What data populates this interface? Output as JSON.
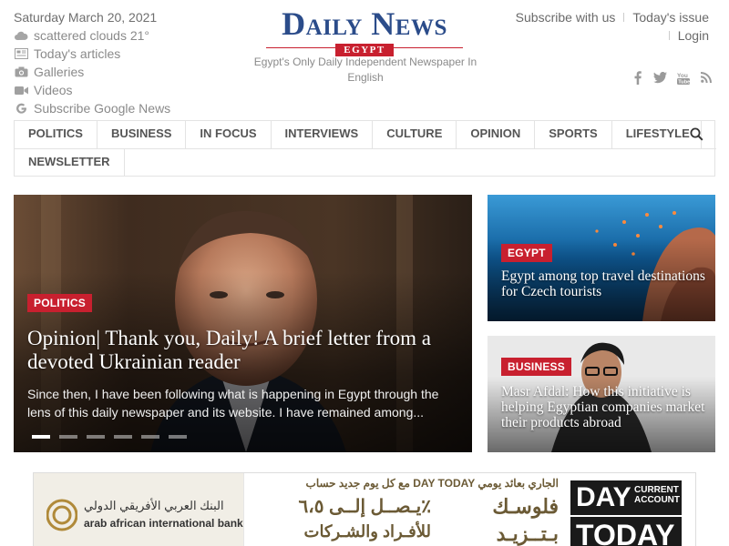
{
  "header": {
    "date": "Saturday March 20, 2021",
    "weather": "scattered clouds 21°",
    "links": [
      {
        "label": "Today's articles",
        "icon": "newspaper-icon"
      },
      {
        "label": "Galleries",
        "icon": "camera-icon"
      },
      {
        "label": "Videos",
        "icon": "video-icon"
      },
      {
        "label": "Subscribe Google News",
        "icon": "google-icon"
      }
    ],
    "logo": {
      "wordmark": "Daily News",
      "sub": "EGYPT"
    },
    "tagline": "Egypt's Only Daily Independent Newspaper In English",
    "right_links": {
      "subscribe": "Subscribe with us",
      "todays_issue": "Today's issue",
      "login": "Login"
    },
    "social_icons": [
      "facebook-icon",
      "twitter-icon",
      "youtube-icon",
      "rss-icon"
    ]
  },
  "nav": {
    "row1": [
      "POLITICS",
      "BUSINESS",
      "IN FOCUS",
      "INTERVIEWS",
      "CULTURE",
      "OPINION",
      "SPORTS",
      "LIFESTYLE"
    ],
    "row2": [
      "NEWSLETTER"
    ]
  },
  "hero": {
    "category": "POLITICS",
    "title": "Opinion| Thank you, Daily! A brief letter from a devoted Ukrainian reader",
    "excerpt": "Since then, I have been following what is happening in Egypt through the lens of this daily newspaper and its website. I have remained among...",
    "slide_count": 6,
    "active_slide": 1
  },
  "cards": [
    {
      "category": "EGYPT",
      "title": "Egypt among top travel destinations for Czech tourists"
    },
    {
      "category": "BUSINESS",
      "title": "Masr Afdal: How this initiative is helping Egyptian companies market their products abroad"
    }
  ],
  "ad": {
    "bank_en": "arab african international bank",
    "bank_ar": "البنك العربي الأفريقي الدولي",
    "mid_line1": "مع كل يوم جديد حساب DAY TODAY الجاري بعائد يومي",
    "mid_line2_left": "يـصــل إلــى ٦،٥٪",
    "mid_line2_right": "فلوسـك",
    "mid_line3_left": "للأفـراد والشـركات",
    "mid_line3_right": "بـتــزيـد",
    "day": "DAY",
    "current_account": "CURRENT ACCOUNT",
    "today": "TODAY"
  },
  "colors": {
    "brand_blue": "#2b4c8a",
    "badge_red": "#c8202f"
  }
}
